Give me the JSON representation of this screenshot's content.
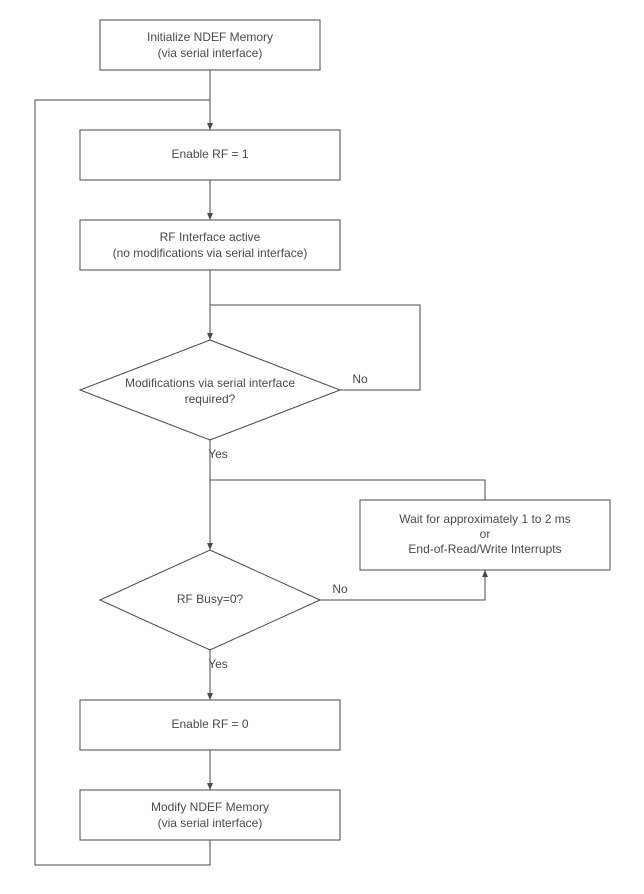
{
  "nodes": {
    "init": {
      "line1": "Initialize NDEF Memory",
      "line2": "(via serial interface)"
    },
    "enable1": {
      "line1": "Enable RF = 1"
    },
    "rfactive": {
      "line1": "RF Interface active",
      "line2": "(no modifications via serial interface)"
    },
    "dec_mod": {
      "line1": "Modifications via serial interface",
      "line2": "required?"
    },
    "dec_busy": {
      "line1": "RF Busy=0?"
    },
    "wait": {
      "line1": "Wait for approximately 1 to 2 ms",
      "line2": "or",
      "line3": "End-of-Read/Write Interrupts"
    },
    "enable0": {
      "line1": "Enable RF = 0"
    },
    "modify": {
      "line1": "Modify NDEF Memory",
      "line2": "(via serial interface)"
    }
  },
  "labels": {
    "yes": "Yes",
    "no": "No"
  }
}
